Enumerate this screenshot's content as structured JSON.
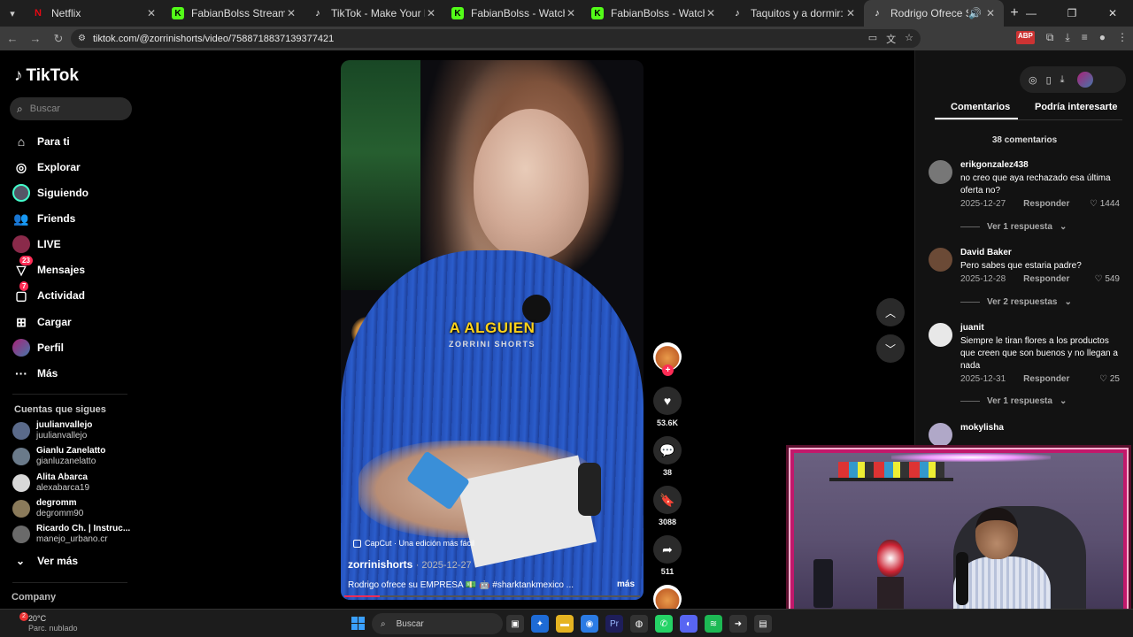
{
  "browser": {
    "tabs": [
      {
        "title": "Netflix",
        "favicon": "netflix-icon",
        "active": false
      },
      {
        "title": "FabianBolss Stream - Watch Live",
        "favicon": "kick-icon",
        "active": false
      },
      {
        "title": "TikTok - Make Your Day",
        "favicon": "tiktok-icon",
        "active": false
      },
      {
        "title": "FabianBolss - Watch clips on Kick",
        "favicon": "kick-icon",
        "active": false
      },
      {
        "title": "FabianBolss - Watch clips on Kick",
        "favicon": "kick-icon",
        "active": false
      },
      {
        "title": "Taquitos y a dormir: el mejor plan",
        "favicon": "tiktok-icon",
        "active": false
      },
      {
        "title": "Rodrigo Ofrece Su Empresa",
        "favicon": "tiktok-icon",
        "active": true
      }
    ],
    "url": "tiktok.com/@zorrinishorts/video/7588718837139377421"
  },
  "sidebar": {
    "logo": "TikTok",
    "search_placeholder": "Buscar",
    "nav": [
      {
        "label": "Para ti",
        "icon": "home-icon"
      },
      {
        "label": "Explorar",
        "icon": "compass-icon"
      },
      {
        "label": "Siguiendo",
        "icon": "following-avatar-icon"
      },
      {
        "label": "Friends",
        "icon": "friends-icon"
      },
      {
        "label": "LIVE",
        "icon": "live-icon"
      },
      {
        "label": "Mensajes",
        "icon": "messages-icon",
        "badge": "23"
      },
      {
        "label": "Actividad",
        "icon": "activity-icon",
        "badge": "7"
      },
      {
        "label": "Cargar",
        "icon": "upload-icon"
      },
      {
        "label": "Perfil",
        "icon": "profile-avatar-icon"
      },
      {
        "label": "Más",
        "icon": "more-icon"
      }
    ],
    "following_title": "Cuentas que sigues",
    "following": [
      {
        "name": "juulianvallejo",
        "username": "juulianvallejo",
        "color": "#5a6a8a"
      },
      {
        "name": "Gianlu Zanelatto",
        "username": "gianluzanelatto",
        "color": "#6a7a8a"
      },
      {
        "name": "Alita Abarca",
        "username": "alexabarca19",
        "color": "#d8d8d8"
      },
      {
        "name": "degromm",
        "username": "degromm90",
        "color": "#8a7a5a"
      },
      {
        "name": "Ricardo Ch. | Instruc...",
        "username": "manejo_urbano.cr",
        "color": "#6a6a6a"
      }
    ],
    "see_more": "Ver más",
    "company": "Company"
  },
  "video": {
    "caption_main": "A ALGUIEN",
    "caption_sub": "ZORRINI SHORTS",
    "capcut": "CapCut · Una edición más fácil",
    "author": "zorrinishorts",
    "date": "· 2025-12-27",
    "description": "Rodrigo ofrece su EMPRESA 💵 🤖 #sharktankmexico ...",
    "more": "más",
    "progress": 0.12
  },
  "actions": {
    "likes": "53.6K",
    "comments": "38",
    "saves": "3088",
    "shares": "511"
  },
  "comments_panel": {
    "tab_comments": "Comentarios",
    "tab_interest": "Podría interesarte",
    "count": "38 comentarios",
    "reply_label": "Responder",
    "comments": [
      {
        "user": "erikgonzalez438",
        "text": "no creo que aya rechazado esa última oferta no?",
        "date": "2025-12-27",
        "likes": "1444",
        "replies": "Ver 1 respuesta",
        "avatar_color": "#777"
      },
      {
        "user": "David Baker",
        "text": "Pero sabes que estaria padre?",
        "date": "2025-12-28",
        "likes": "549",
        "replies": "Ver 2 respuestas",
        "avatar_color": "#6b4a36"
      },
      {
        "user": "juanit",
        "text": "Siempre le tiran flores a los productos que creen que son buenos y no llegan a nada",
        "date": "2025-12-31",
        "likes": "25",
        "replies": "Ver 1 respuesta",
        "avatar_color": "#e8e8e8"
      },
      {
        "user": "mokylisha",
        "text": "",
        "date": "",
        "likes": "",
        "replies": "",
        "avatar_color": "#b0a8c8"
      }
    ]
  },
  "taskbar": {
    "weather_temp": "20°C",
    "weather_desc": "Parc. nublado",
    "weather_badge": "2",
    "search": "Buscar"
  }
}
